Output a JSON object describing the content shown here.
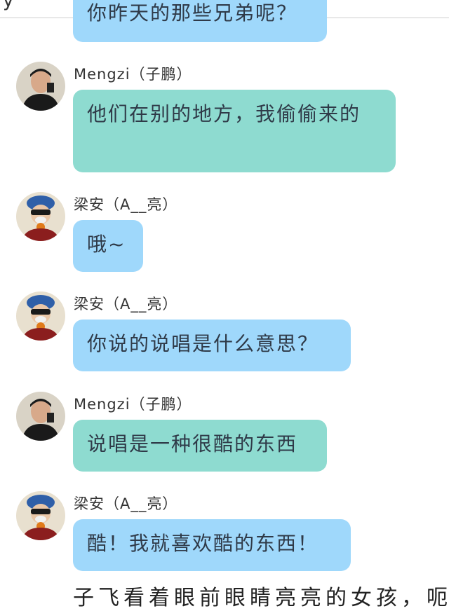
{
  "top": {
    "partial_text": "y"
  },
  "top_bubble": {
    "text": "你昨天的那些兄弟呢？"
  },
  "messages": [
    {
      "name": "Mengzi（子鹏）",
      "text": "他们在别的地方，我偷偷来的",
      "color": "#8edbd0"
    },
    {
      "name": "梁安（A__亮）",
      "text": "哦~",
      "color": "#9fd8fb"
    },
    {
      "name": "梁安（A__亮）",
      "text": "你说的说唱是什么意思？",
      "color": "#9fd8fb"
    },
    {
      "name": "Mengzi（子鹏）",
      "text": "说唱是一种很酷的东西",
      "color": "#8edbd0"
    },
    {
      "name": "梁安（A__亮）",
      "text": "酷！我就喜欢酷的东西！",
      "color": "#9fd8fb"
    }
  ],
  "bottom_text": "子飞看着眼前眼睛亮亮的女孩，呃"
}
